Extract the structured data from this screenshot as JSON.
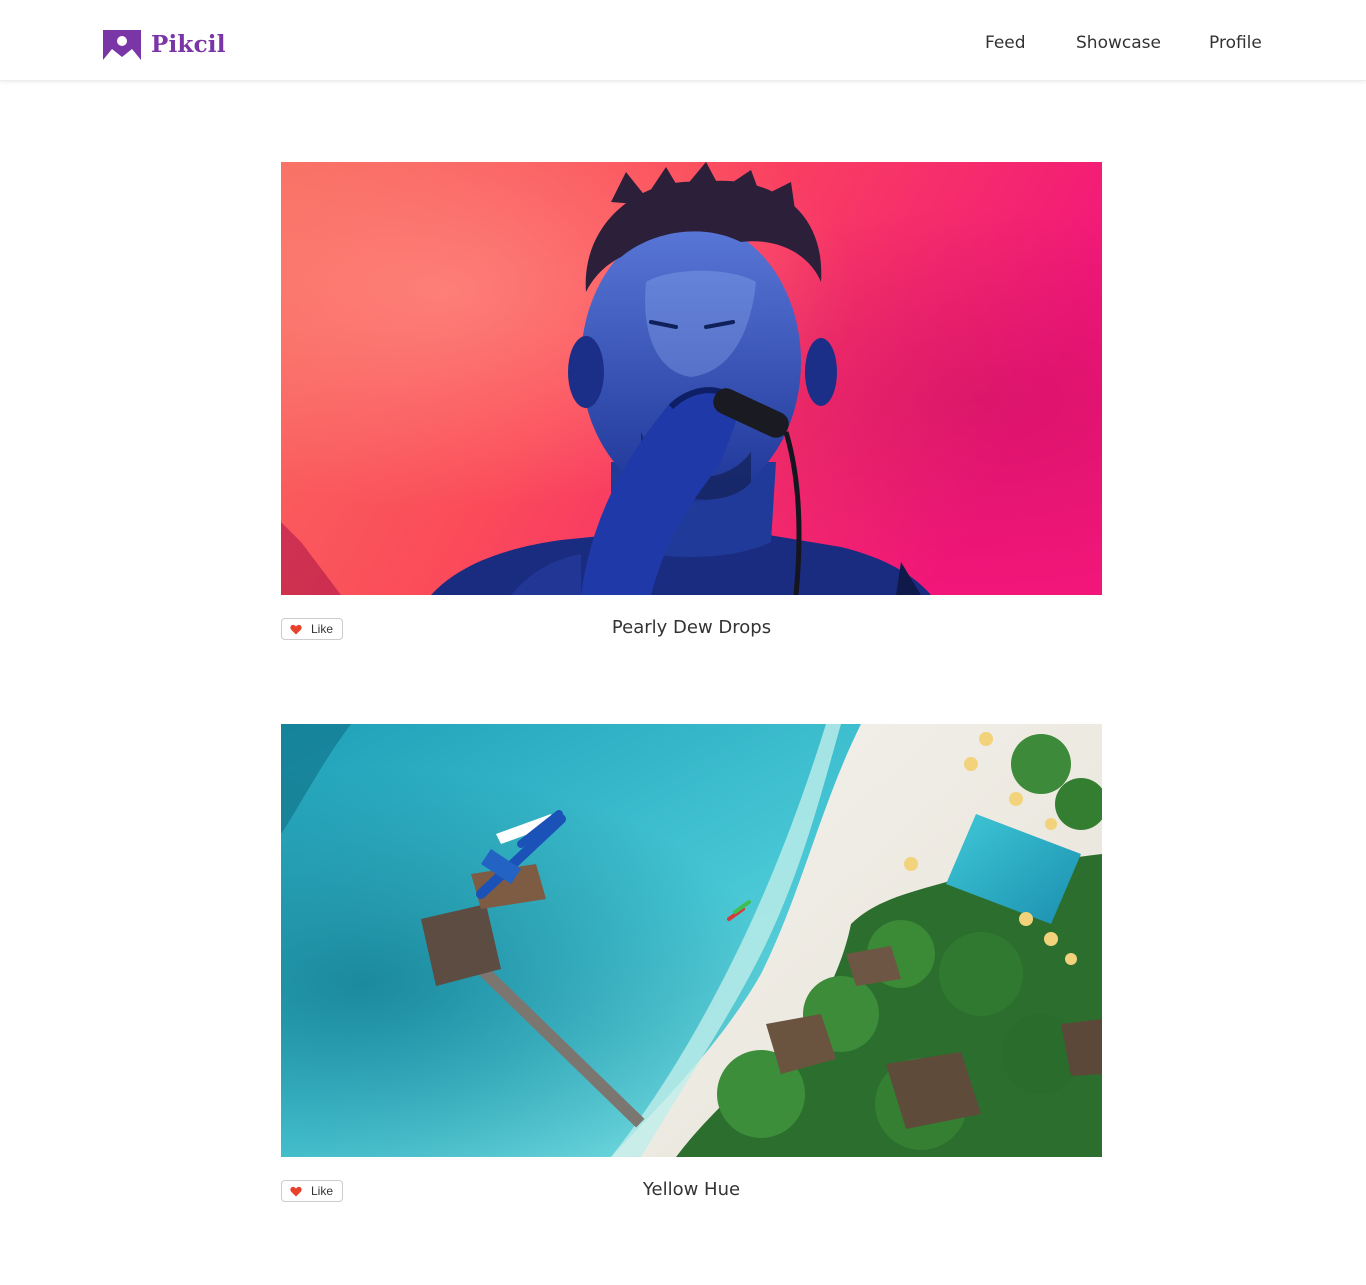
{
  "app": {
    "name": "Pikcil",
    "brand_color": "#7a35a6"
  },
  "nav": {
    "items": [
      {
        "label": "Feed"
      },
      {
        "label": "Showcase"
      },
      {
        "label": "Profile"
      }
    ]
  },
  "feed": {
    "posts": [
      {
        "title": "Pearly Dew Drops",
        "like_label": "Like",
        "image_alt": "singer with blue face paint holding a microphone against a red-pink background"
      },
      {
        "title": "Yellow Hue",
        "like_label": "Like",
        "image_alt": "aerial view of turquoise lagoon, beach, jetty and tropical resort"
      }
    ]
  },
  "icons": {
    "logo": "pikcil-logo-icon",
    "like": "heart-icon",
    "like_color": "#e8412c"
  }
}
